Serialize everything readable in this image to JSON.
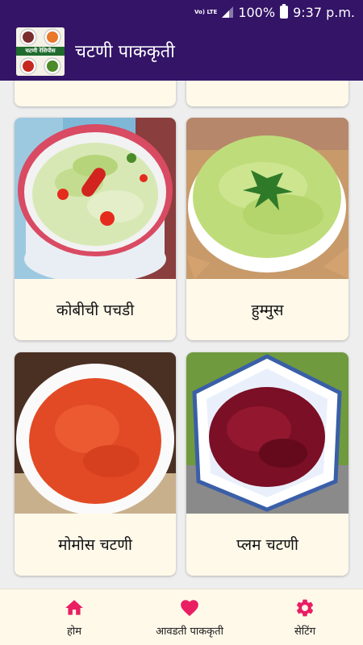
{
  "status_bar": {
    "network": "Vo) LTE",
    "battery": "100%",
    "time": "9:37 p.m."
  },
  "app_bar": {
    "title": "चटणी पाककृती",
    "logo_text": "चटणी रेसिपीस"
  },
  "recipes": [
    {
      "name": "कोबीची पचडी"
    },
    {
      "name": "हुम्मुस"
    },
    {
      "name": "मोमोस चटणी"
    },
    {
      "name": "प्लम चटणी"
    }
  ],
  "bottom_nav": {
    "home": "होम",
    "favorites": "आवडती पाककृती",
    "settings": "सेटिंग"
  },
  "colors": {
    "primary": "#331467",
    "accent": "#e91e63",
    "card_bg": "#fff9ea",
    "page_bg": "#eeeeee"
  }
}
